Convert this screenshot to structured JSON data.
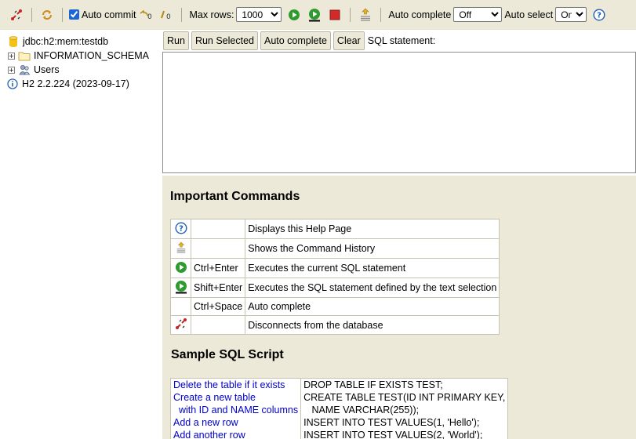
{
  "toolbar": {
    "auto_commit_label": "Auto commit",
    "auto_commit_checked": true,
    "max_rows_label": "Max rows:",
    "max_rows_value": "1000",
    "auto_complete_label": "Auto complete",
    "auto_complete_value": "Off",
    "auto_select_label": "Auto select",
    "auto_select_value": "On",
    "help_glyph": "?"
  },
  "tree": {
    "connection": "jdbc:h2:mem:testdb",
    "items": [
      {
        "label": "INFORMATION_SCHEMA",
        "icon": "folder-icon",
        "expander": "+"
      },
      {
        "label": "Users",
        "icon": "users-icon",
        "expander": "+"
      }
    ],
    "version": "H2 2.2.224 (2023-09-17)"
  },
  "query": {
    "run": "Run",
    "run_selected": "Run Selected",
    "auto_complete": "Auto complete",
    "clear": "Clear",
    "sql_label": "SQL statement:",
    "sql_value": ""
  },
  "result": {
    "important_title": "Important Commands",
    "commands": [
      {
        "icon": "help-icon",
        "key": "",
        "desc": "Displays this Help Page"
      },
      {
        "icon": "history-icon",
        "key": "",
        "desc": "Shows the Command History"
      },
      {
        "icon": "run-icon",
        "key": "Ctrl+Enter",
        "desc": "Executes the current SQL statement"
      },
      {
        "icon": "run-selected-icon",
        "key": "Shift+Enter",
        "desc": "Executes the SQL statement defined by the text selection"
      },
      {
        "icon": "",
        "key": "Ctrl+Space",
        "desc": "Auto complete"
      },
      {
        "icon": "disconnect-icon",
        "key": "",
        "desc": "Disconnects from the database"
      }
    ],
    "sample_title": "Sample SQL Script",
    "sample_rows": [
      {
        "link": "Delete the table if it exists",
        "sql": "DROP TABLE IF EXISTS TEST;"
      },
      {
        "link": "Create a new table",
        "sql": "CREATE TABLE TEST(ID INT PRIMARY KEY,"
      },
      {
        "link": "  with ID and NAME columns",
        "sql": "   NAME VARCHAR(255));"
      },
      {
        "link": "Add a new row",
        "sql": "INSERT INTO TEST VALUES(1, 'Hello');"
      },
      {
        "link": "Add another row",
        "sql": "INSERT INTO TEST VALUES(2, 'World');"
      }
    ]
  },
  "colors": {
    "toolbar_bg": "#ece9d8",
    "link": "#0000cc",
    "run_green": "#2f9a2f",
    "stop_red": "#d12a2a"
  }
}
